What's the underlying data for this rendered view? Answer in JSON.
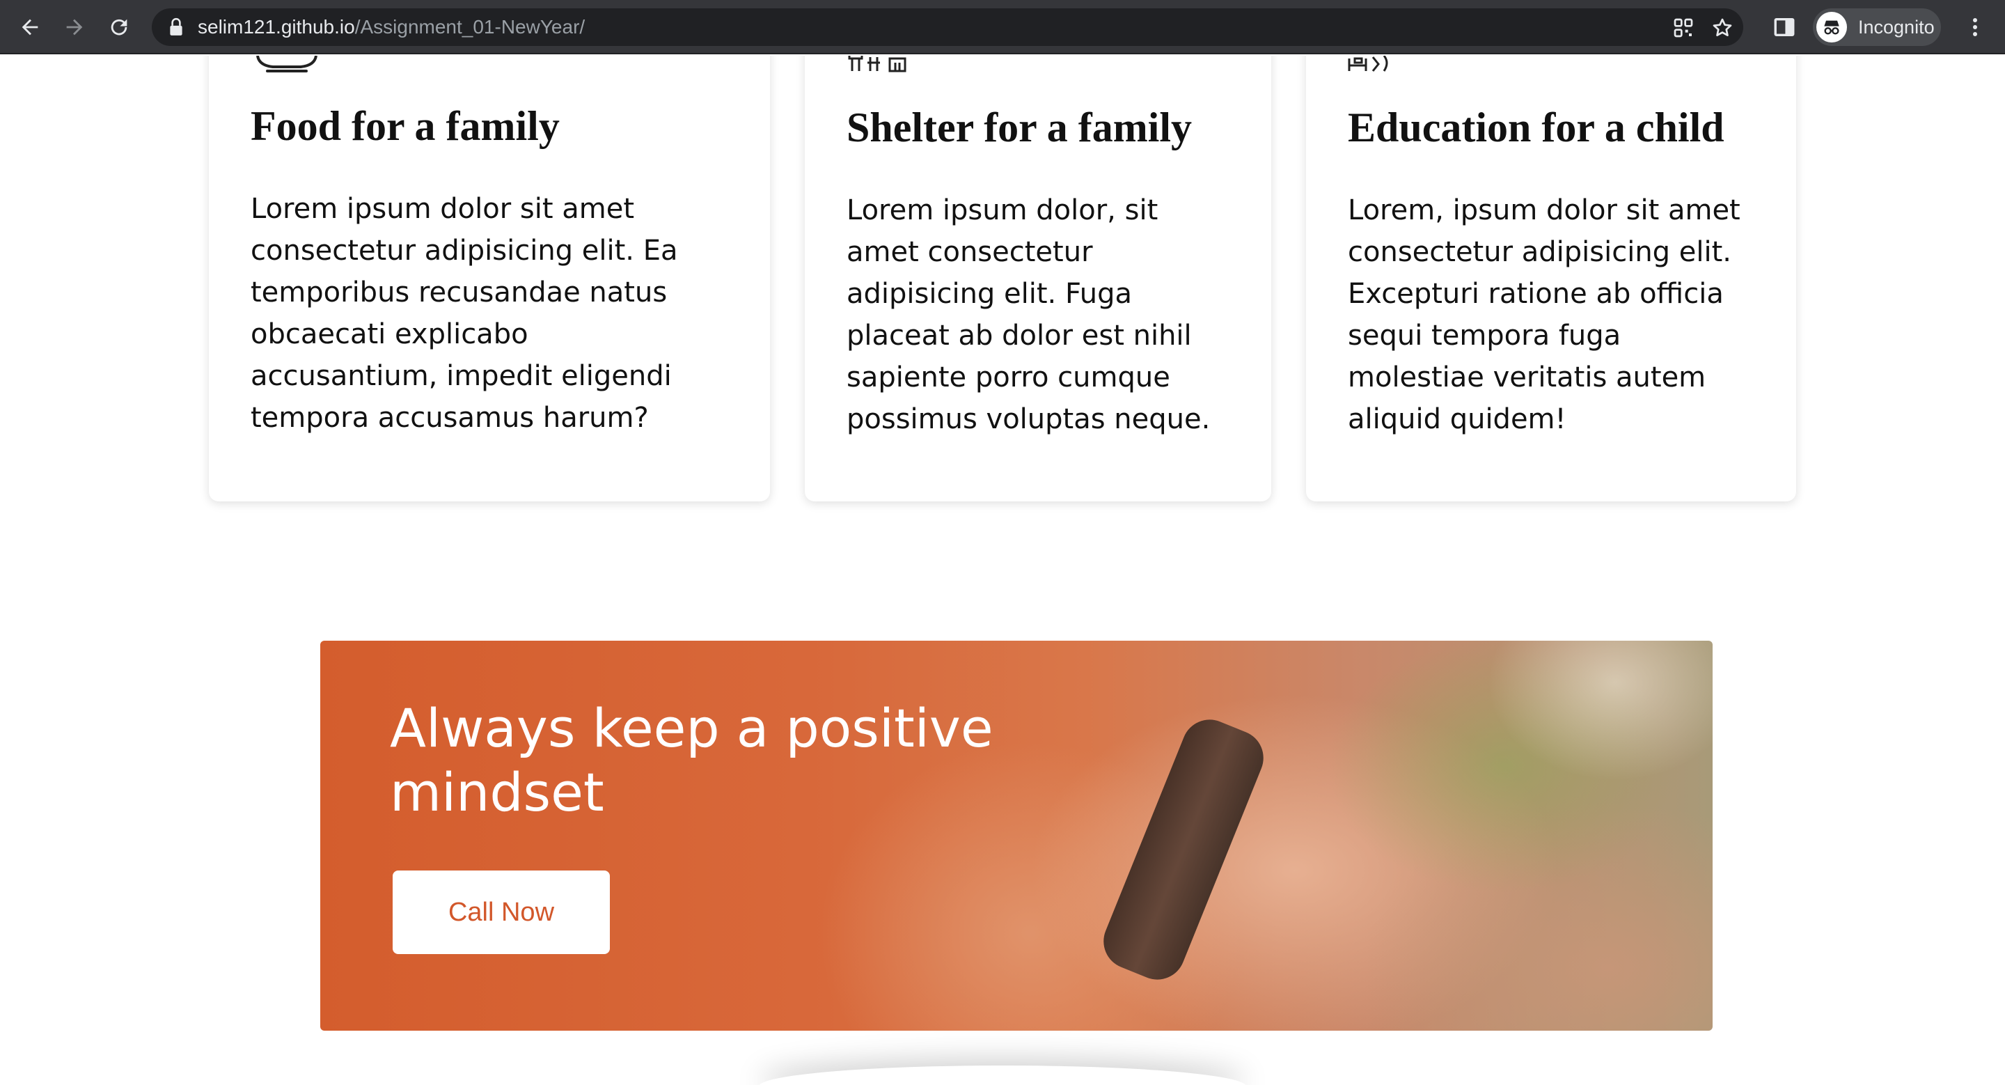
{
  "browser": {
    "url_host": "selim121.github.io",
    "url_path": "/Assignment_01-NewYear/",
    "profile_label": "Incognito",
    "icons": [
      "back-arrow-icon",
      "forward-arrow-icon",
      "reload-icon",
      "lock-icon",
      "qr-code-icon",
      "star-icon",
      "side-panel-icon",
      "incognito-icon",
      "more-vert-icon"
    ]
  },
  "cards": [
    {
      "title": "Food for a family",
      "icon": "food-bowl-icon",
      "lines": [
        "Lorem ipsum dolor sit amet",
        "consectetur adipisicing elit. Ea",
        "temporibus recusandae natus",
        "obcaecati explicabo",
        "accusantium, impedit eligendi",
        "tempora accusamus harum?"
      ]
    },
    {
      "title": "Shelter for a family",
      "icon": "shelter-icon",
      "lines": [
        "Lorem ipsum dolor, sit",
        "amet consectetur",
        "adipisicing elit. Fuga",
        "placeat ab dolor est nihil",
        "sapiente porro cumque",
        "possimus voluptas neque."
      ]
    },
    {
      "title": "Education for a child",
      "icon": "education-desk-icon",
      "lines": [
        "Lorem, ipsum dolor sit amet",
        "consectetur adipisicing elit.",
        "Excepturi ratione ab officia",
        "sequi tempora fuga",
        "molestiae veritatis autem",
        "aliquid quidem!"
      ]
    }
  ],
  "banner": {
    "title_lines": [
      "Always keep a positive",
      "mindset"
    ],
    "button_label": "Call Now"
  },
  "colors": {
    "accent": "#d2572a",
    "chrome_bg": "#35363a",
    "omnibox_bg": "#202124"
  }
}
